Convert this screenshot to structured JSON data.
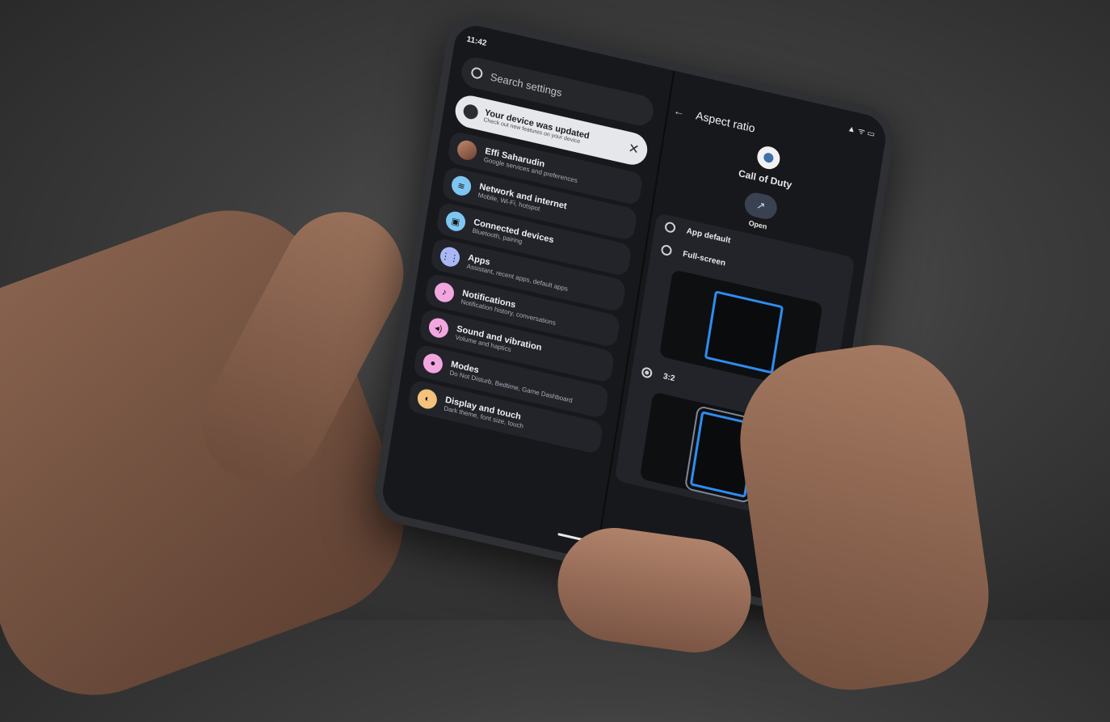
{
  "left": {
    "status": "11:42",
    "search_placeholder": "Search settings",
    "banner": {
      "title": "Your device was updated",
      "subtitle": "Check out new features on your device",
      "close": "✕"
    },
    "items": [
      {
        "title": "Effi Saharudin",
        "subtitle": "Google services and preferences",
        "icon": "avatar",
        "color": "#b07a60"
      },
      {
        "title": "Network and internet",
        "subtitle": "Mobile, Wi-Fi, hotspot",
        "icon": "wifi-icon",
        "color": "#7ec6f2"
      },
      {
        "title": "Connected devices",
        "subtitle": "Bluetooth, pairing",
        "icon": "devices-icon",
        "color": "#7ec6f2"
      },
      {
        "title": "Apps",
        "subtitle": "Assistant, recent apps, default apps",
        "icon": "apps-icon",
        "color": "#a9b8f5"
      },
      {
        "title": "Notifications",
        "subtitle": "Notification history, conversations",
        "icon": "bell-icon",
        "color": "#f2a6e0"
      },
      {
        "title": "Sound and vibration",
        "subtitle": "Volume and haptics",
        "icon": "volume-icon",
        "color": "#f2a6e0"
      },
      {
        "title": "Modes",
        "subtitle": "Do Not Disturb, Bedtime, Game Dashboard",
        "icon": "modes-icon",
        "color": "#f2a6e0"
      },
      {
        "title": "Display and touch",
        "subtitle": "Dark theme, font size, touch",
        "icon": "display-icon",
        "color": "#f4c27a"
      }
    ]
  },
  "right": {
    "header": "Aspect ratio",
    "back_glyph": "←",
    "app_name": "Call of Duty",
    "open_glyph": "↗",
    "open_label": "Open",
    "options": [
      {
        "label": "App default",
        "selected": false
      },
      {
        "label": "Full-screen",
        "selected": false
      },
      {
        "label": "3:2",
        "selected": true
      }
    ]
  },
  "colors": {
    "accent": "#2f8cf0",
    "banner_bg": "#e6e7ea"
  }
}
